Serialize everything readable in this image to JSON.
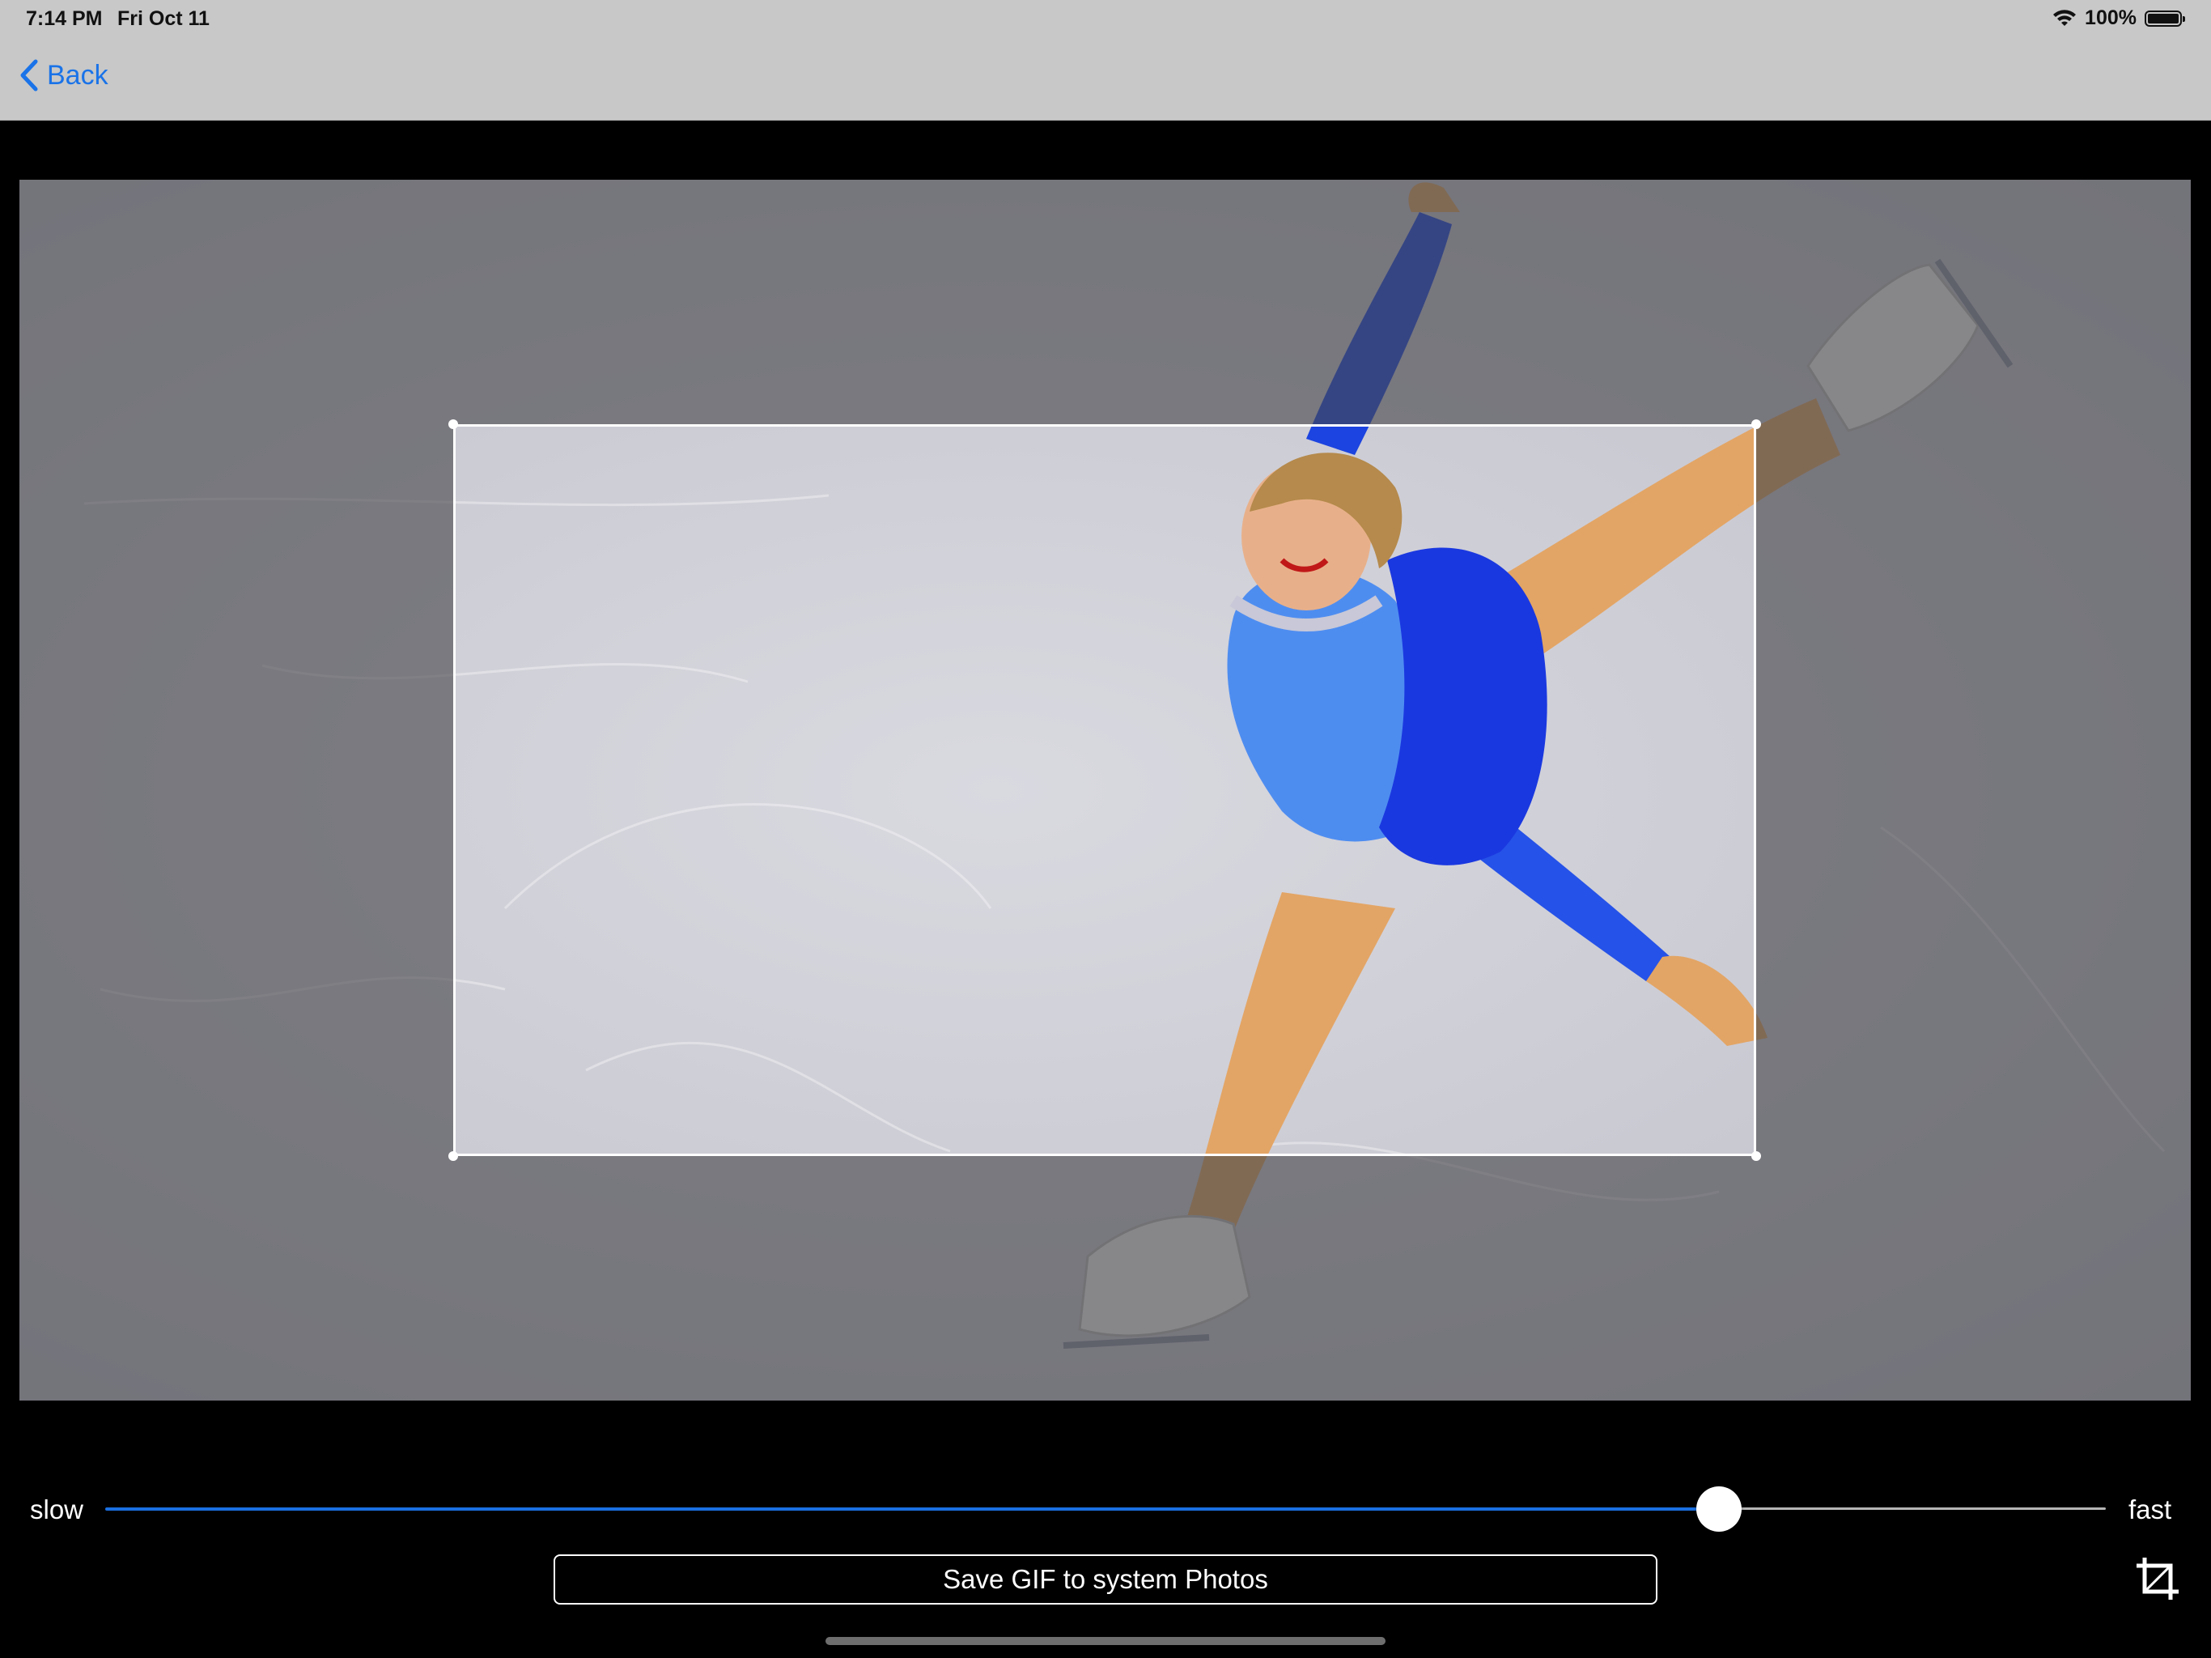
{
  "status_bar": {
    "time": "7:14 PM",
    "date": "Fri Oct 11",
    "battery_percent": "100%",
    "icons": [
      "wifi-icon",
      "battery-icon"
    ]
  },
  "nav": {
    "back_label": "Back",
    "back_icon": "chevron-left-icon",
    "accent_color": "#1a73e8"
  },
  "image": {
    "subject": "figure skater in blue dress performing a spiral on ice",
    "crop_active": true
  },
  "speed_control": {
    "min_label": "slow",
    "max_label": "fast",
    "value_fraction": 0.8,
    "track_color": "#1a6fe0"
  },
  "actions": {
    "save_label": "Save GIF to system Photos",
    "crop_icon": "crop-icon"
  }
}
